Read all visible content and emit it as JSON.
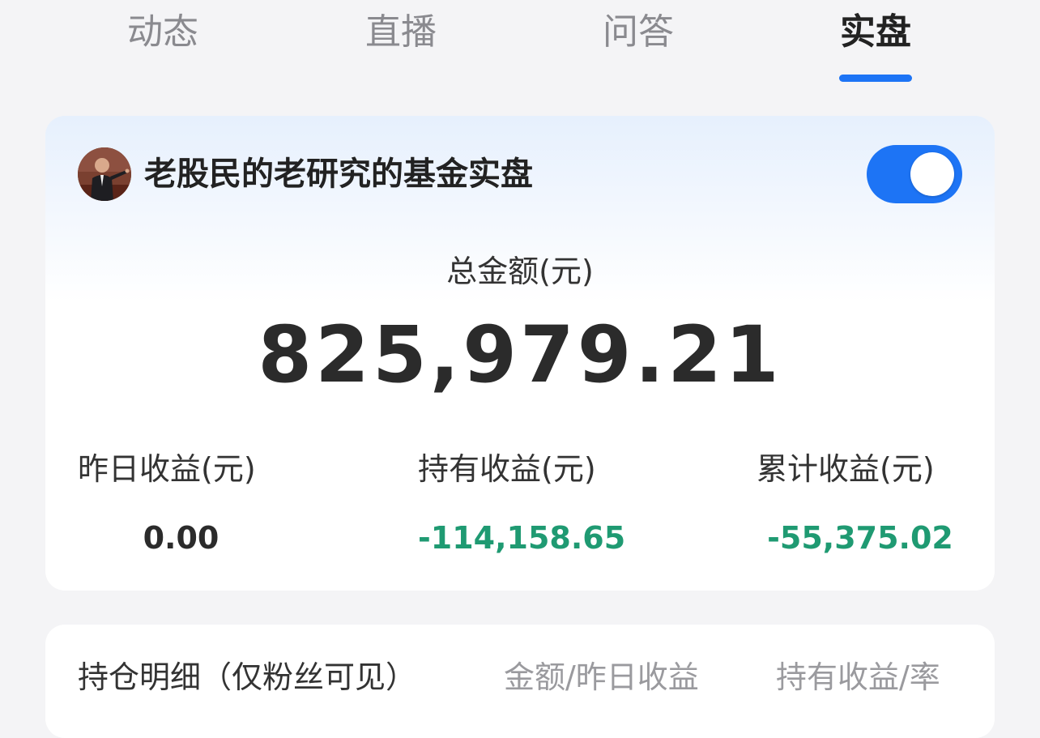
{
  "tabs": [
    {
      "label": "动态",
      "active": false
    },
    {
      "label": "直播",
      "active": false
    },
    {
      "label": "问答",
      "active": false
    },
    {
      "label": "实盘",
      "active": true
    }
  ],
  "colors": {
    "accent": "#1d74f5",
    "loss_green": "#1f9a72",
    "neutral_text": "#2b2b2b"
  },
  "portfolio": {
    "title": "老股民的老研究的基金实盘",
    "toggle_on": true,
    "total_label": "总金额(元)",
    "total_value": "825,979.21",
    "stats": [
      {
        "label": "昨日收益(元)",
        "value": "0.00"
      },
      {
        "label": "持有收益(元)",
        "value": "-114,158.65"
      },
      {
        "label": "累计收益(元)",
        "value": "-55,375.02"
      }
    ]
  },
  "holdings": {
    "title": "持仓明细（仅粉丝可见）",
    "col_amount": "金额/昨日收益",
    "col_profit": "持有收益/率"
  }
}
